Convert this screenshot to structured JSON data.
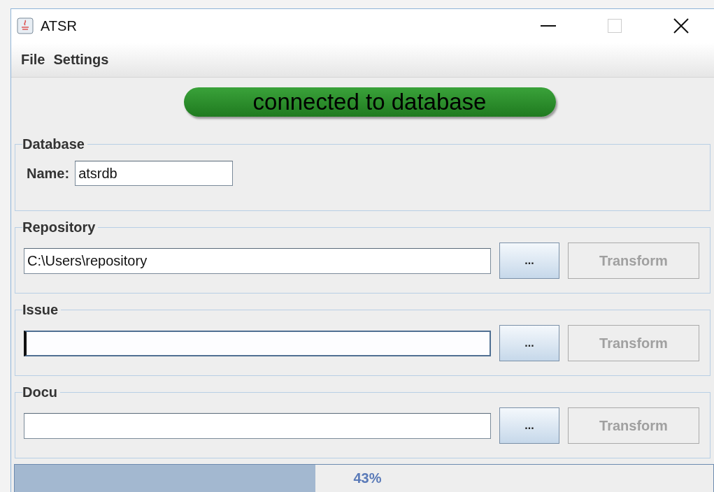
{
  "window": {
    "title": "ATSR"
  },
  "menu": [
    {
      "label": "File"
    },
    {
      "label": "Settings"
    }
  ],
  "status": {
    "text": "connected to database",
    "connected": true
  },
  "database": {
    "title": "Database",
    "name_label": "Name:",
    "name_value": "atsrdb"
  },
  "sections": [
    {
      "title": "Repository",
      "value": "C:\\Users\\repository",
      "focused": false,
      "browse": "...",
      "transform": "Transform",
      "disabled": true
    },
    {
      "title": "Issue",
      "focused": true,
      "browse": "...",
      "transform": "Transform",
      "disabled": true
    },
    {
      "title": "Docu",
      "focused": false,
      "browse": "...",
      "transform": "Transform",
      "disabled": true
    }
  ],
  "progress": {
    "level": 0.43,
    "reading": "43%"
  }
}
